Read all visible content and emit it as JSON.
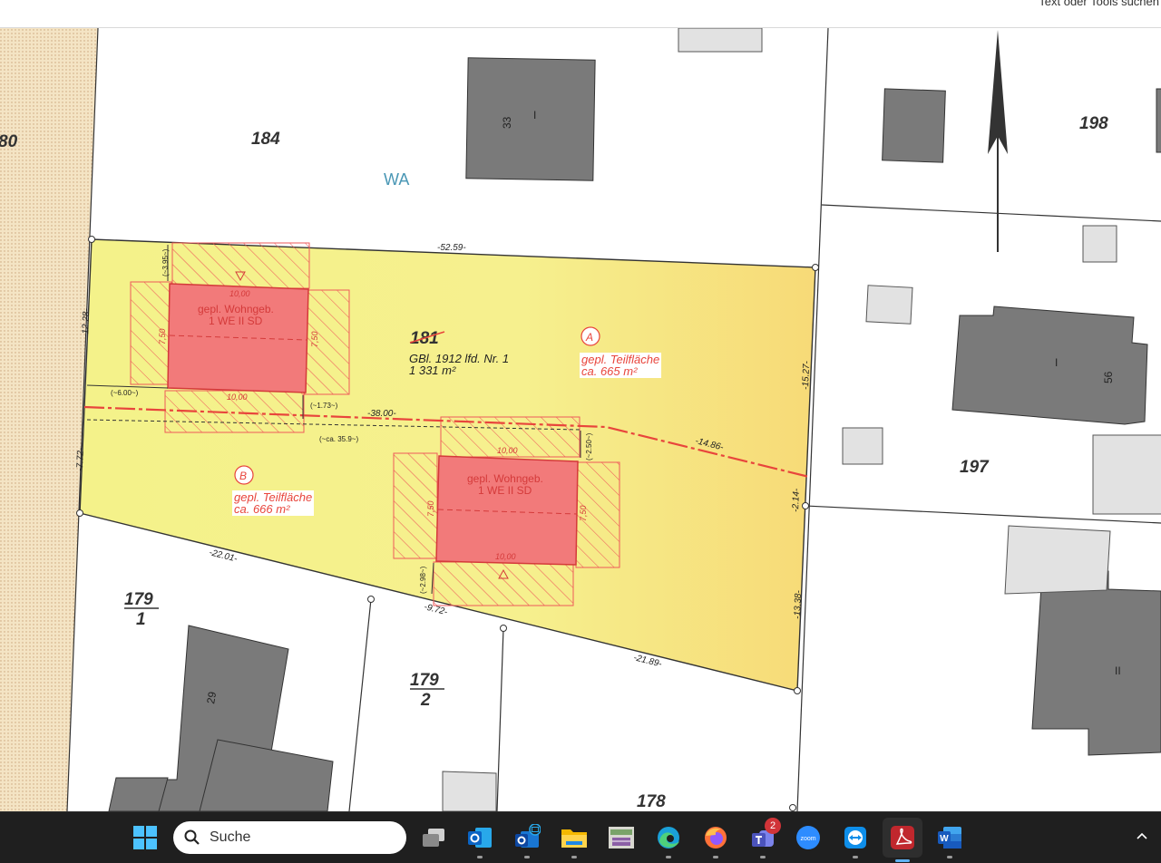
{
  "toolbar": {
    "search_tools_label": "Text oder Tools suchen"
  },
  "plan": {
    "plot_neighbors": {
      "p180": "80",
      "p184": "184",
      "p198": "198",
      "p197": "197",
      "p179_1_num": "179",
      "p179_1_den": "1",
      "p179_2_num": "179",
      "p179_2_den": "2",
      "p178": "178"
    },
    "zone_label": "WA",
    "main_plot": {
      "number": "181",
      "gbl_line": "GBl. 1912 lfd. Nr. 1",
      "area": "1 331 m²"
    },
    "partial_a": {
      "marker": "A",
      "line1": "gepl. Teilfläche",
      "line2": "ca. 665 m²"
    },
    "partial_b": {
      "marker": "B",
      "line1": "gepl. Teilfläche",
      "line2": "ca. 666 m²"
    },
    "house_a": {
      "line1": "gepl. Wohngeb.",
      "line2": "1 WE II SD"
    },
    "house_b": {
      "line1": "gepl. Wohngeb.",
      "line2": "1 WE II SD"
    },
    "building_numbers": {
      "b33": "33",
      "b29": "29",
      "b56": "56"
    },
    "storey_marks": {
      "s33": "I",
      "s56": "I",
      "right_bottom": "II"
    },
    "dimensions": {
      "top": "-52.59-",
      "left_upper": "-12.28-",
      "left_lower": "-7.72-",
      "right_upper": "-15.27-",
      "right_mid": "-2.14-",
      "right_lower": "-13.38-",
      "split_left": "-38.00-",
      "split_right": "-14.86-",
      "bottom_left": "-22.01-",
      "bottom_mid": "-9.72-",
      "bottom_right": "-21.89-",
      "offset_top": "(~3.95~)",
      "offset_left": "(~6.00~)",
      "offset_mid": "(~1.73~)",
      "offset_total": "(~ca. 35.9~)",
      "offset_b_top": "(~2.50~)",
      "offset_b_bottom": "(~2.98~)",
      "house_w_a_top": "10,00",
      "house_w_a_bottom": "10,00",
      "house_h_a_left": "7,50",
      "house_h_a_right": "7,50",
      "house_w_b_top": "10,00",
      "house_w_b_bottom": "10,00",
      "house_h_b_left": "7,50",
      "house_h_b_right": "7,50"
    }
  },
  "taskbar": {
    "search_placeholder": "Suche",
    "teams_badge": "2",
    "zoom_label": "zoom",
    "word_letter": "W"
  }
}
